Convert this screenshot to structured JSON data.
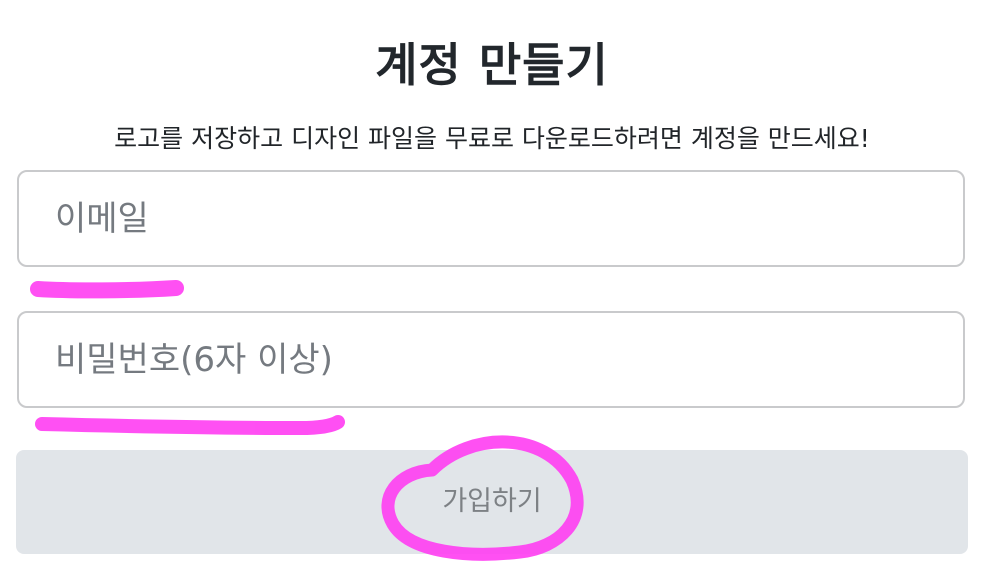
{
  "page": {
    "title": "계정 만들기",
    "subtitle": "로고를 저장하고 디자인 파일을 무료로 다운로드하려면 계정을 만드세요!"
  },
  "form": {
    "email": {
      "placeholder": "이메일",
      "value": ""
    },
    "password": {
      "placeholder": "비밀번호(6자 이상)",
      "value": ""
    },
    "submit_label": "가입하기"
  },
  "colors": {
    "title_text": "#22272c",
    "input_border": "#c9cacc",
    "placeholder_text": "#757a80",
    "button_background": "#e1e5e9",
    "button_text": "#7d8185",
    "annotation_marker": "#ff3df2"
  }
}
